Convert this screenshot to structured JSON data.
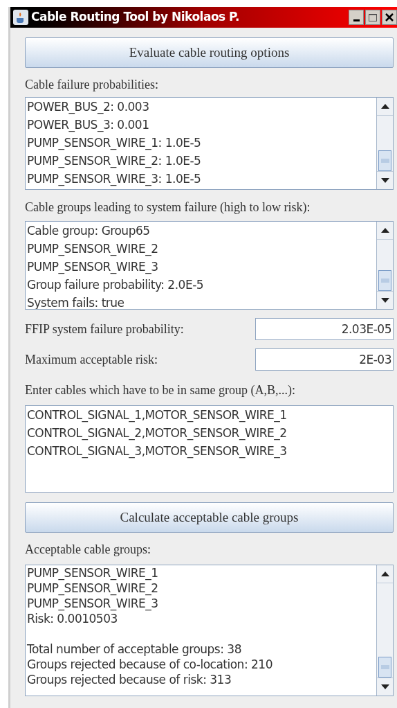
{
  "window": {
    "title": "Cable Routing Tool by Nikolaos P."
  },
  "evaluate_button": "Evaluate cable routing options",
  "failure_probabilities": {
    "label": "Cable failure probabilities:",
    "lines": [
      "POWER_BUS_2: 0.003",
      "POWER_BUS_3: 0.001",
      "PUMP_SENSOR_WIRE_1: 1.0E-5",
      "PUMP_SENSOR_WIRE_2: 1.0E-5",
      "PUMP_SENSOR_WIRE_3: 1.0E-5"
    ]
  },
  "failure_groups": {
    "label": "Cable groups leading to system failure (high to low risk):",
    "lines": [
      "Cable group: Group65",
      "PUMP_SENSOR_WIRE_2",
      "PUMP_SENSOR_WIRE_3",
      "Group failure probability: 2.0E-5",
      "System fails: true"
    ]
  },
  "fields": [
    {
      "label": "FFIP system failure probability:",
      "value": "2.03E-05"
    },
    {
      "label": "Maximum acceptable risk:",
      "value": "2E-03"
    }
  ],
  "same_group": {
    "label": "Enter cables which have to be in same group (A,B,...):",
    "lines": [
      "CONTROL_SIGNAL_1,MOTOR_SENSOR_WIRE_1",
      "CONTROL_SIGNAL_2,MOTOR_SENSOR_WIRE_2",
      "CONTROL_SIGNAL_3,MOTOR_SENSOR_WIRE_3"
    ]
  },
  "calculate_button": "Calculate acceptable cable groups",
  "acceptable": {
    "label": "Acceptable cable groups:",
    "lines": [
      "PUMP_SENSOR_WIRE_1",
      "PUMP_SENSOR_WIRE_2",
      "PUMP_SENSOR_WIRE_3",
      "Risk: 0.0010503"
    ],
    "summary_lines": [
      "Total number of acceptable groups: 38",
      "Groups rejected because of co-location: 210",
      "Groups rejected because of risk: 313"
    ]
  }
}
